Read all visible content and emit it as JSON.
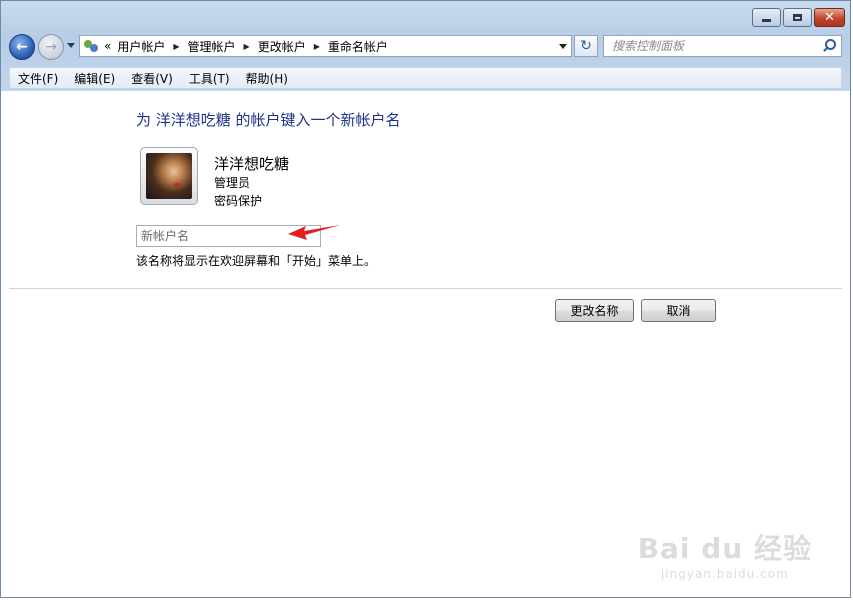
{
  "window": {
    "minimize_icon": "minimize-icon",
    "maximize_icon": "maximize-icon",
    "close_glyph": "✕"
  },
  "nav": {
    "back_icon": "back-arrow-icon",
    "forward_icon": "forward-arrow-icon",
    "back_glyph": "←",
    "forward_glyph": "→"
  },
  "address": {
    "overflow": "«",
    "breadcrumbs": [
      "用户帐户",
      "管理帐户",
      "更改帐户",
      "重命名帐户"
    ],
    "refresh_glyph": "↻"
  },
  "search": {
    "placeholder": "搜索控制面板"
  },
  "menu": [
    "文件(F)",
    "编辑(E)",
    "查看(V)",
    "工具(T)",
    "帮助(H)"
  ],
  "main": {
    "heading": "为 洋洋想吃糖 的帐户键入一个新帐户名",
    "user": {
      "name": "洋洋想吃糖",
      "role": "管理员",
      "protection": "密码保护"
    },
    "input_placeholder": "新帐户名",
    "hint": "该名称将显示在欢迎屏幕和「开始」菜单上。",
    "rename_button": "更改名称",
    "cancel_button": "取消"
  },
  "watermark": {
    "line1": "Bai du 经验",
    "line2": "jingyan.baidu.com"
  },
  "colors": {
    "heading": "#1e3287",
    "arrow": "#e02020"
  }
}
